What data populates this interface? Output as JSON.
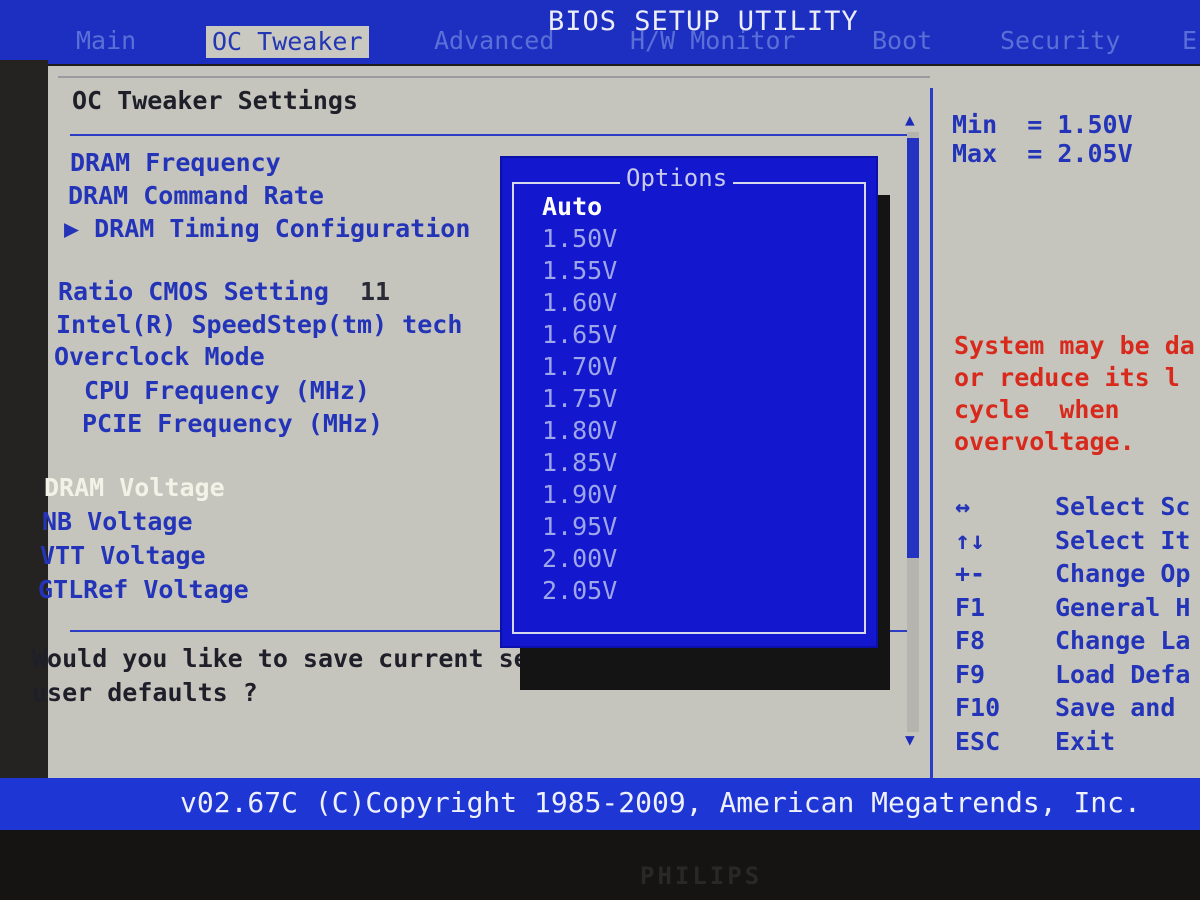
{
  "title": "BIOS SETUP UTILITY",
  "tabs": [
    {
      "label": "Main",
      "active": false
    },
    {
      "label": "OC Tweaker",
      "active": true
    },
    {
      "label": "Advanced",
      "active": false
    },
    {
      "label": "H/W Monitor",
      "active": false
    },
    {
      "label": "Boot",
      "active": false
    },
    {
      "label": "Security",
      "active": false
    },
    {
      "label": "E",
      "active": false
    }
  ],
  "section_title": "OC Tweaker Settings",
  "settings": [
    {
      "label": "DRAM Frequency"
    },
    {
      "label": "DRAM Command Rate"
    },
    {
      "label": "▶ DRAM Timing Configuration"
    },
    {
      "label": "Ratio CMOS Setting",
      "value": "11"
    },
    {
      "label": "Intel(R) SpeedStep(tm) tech"
    },
    {
      "label": "Overclock Mode"
    },
    {
      "label": "CPU Frequency (MHz)"
    },
    {
      "label": "PCIE Frequency (MHz)"
    },
    {
      "label": "DRAM Voltage",
      "selected": true
    },
    {
      "label": "NB Voltage"
    },
    {
      "label": "VTT Voltage"
    },
    {
      "label": "GTLRef Voltage"
    }
  ],
  "prompt": "Would you like to save current setting as\nuser defaults ?",
  "popup": {
    "title": "Options",
    "options": [
      "Auto",
      "1.50V",
      "1.55V",
      "1.60V",
      "1.65V",
      "1.70V",
      "1.75V",
      "1.80V",
      "1.85V",
      "1.90V",
      "1.95V",
      "2.00V",
      "2.05V"
    ],
    "selected_index": 0
  },
  "help": {
    "range": "Min  = 1.50V\nMax  = 2.05V",
    "warning": "System may be da\nor reduce its l\ncycle  when\novervoltage."
  },
  "keys": [
    {
      "key": "↔",
      "desc": "Select Sc"
    },
    {
      "key": "↑↓",
      "desc": "Select It"
    },
    {
      "key": "+-",
      "desc": "Change Op"
    },
    {
      "key": "F1",
      "desc": "General H"
    },
    {
      "key": "F8",
      "desc": "Change La"
    },
    {
      "key": "F9",
      "desc": "Load Defa"
    },
    {
      "key": "F10",
      "desc": "Save and"
    },
    {
      "key": "ESC",
      "desc": "Exit"
    }
  ],
  "footer": "v02.67C (C)Copyright 1985-2009, American Megatrends, Inc.",
  "bezel_brand": "PHILIPS",
  "colors": {
    "bios_blue": "#1c2fc0",
    "panel_gray": "#c6c5bd",
    "item_blue": "#2434b8",
    "warning_red": "#d82a1c",
    "popup_blue": "#1318ce"
  }
}
